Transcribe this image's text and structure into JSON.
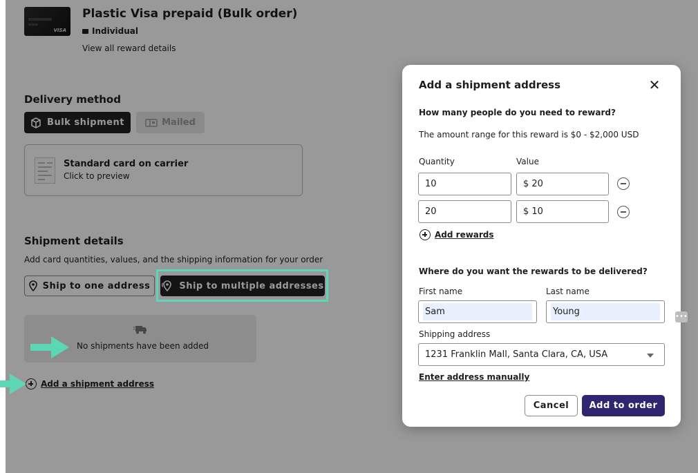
{
  "reward": {
    "title": "Plastic Visa prepaid (Bulk order)",
    "type": "Individual",
    "details_link": "View all reward details",
    "card_brand": "VISA"
  },
  "delivery": {
    "title": "Delivery method",
    "bulk_label": "Bulk shipment",
    "mailed_label": "Mailed",
    "carrier_title": "Standard card on carrier",
    "carrier_sub": "Click to preview"
  },
  "shipment": {
    "title": "Shipment details",
    "description": "Add card quantities, values, and the shipping information for your order",
    "one_address_label": "Ship to one address",
    "multi_address_label": "Ship to multiple addresses",
    "empty_text": "No shipments have been added",
    "add_address_link": "Add a shipment address"
  },
  "modal": {
    "title": "Add a shipment address",
    "question_people": "How many people do you need to reward?",
    "range_text": "The amount range for this reward is $0 - $2,000 USD",
    "quantity_label": "Quantity",
    "value_label": "Value",
    "rows": [
      {
        "quantity": "10",
        "value": "$ 20"
      },
      {
        "quantity": "20",
        "value": "$ 10"
      }
    ],
    "add_rewards_label": "Add rewards",
    "question_delivery": "Where do you want the rewards to be delivered?",
    "first_name_label": "First name",
    "last_name_label": "Last name",
    "first_name_value": "Sam",
    "last_name_value": "Young",
    "shipping_label": "Shipping address",
    "shipping_value": "1231 Franklin Mall, Santa Clara, CA, USA",
    "manual_link": "Enter address manually",
    "cancel_label": "Cancel",
    "add_label": "Add to order",
    "close_glyph": "✕",
    "dots_glyph": "•••"
  },
  "colors": {
    "accent": "#5dd6b5",
    "primary": "#2e2770",
    "dark_button": "#222222",
    "overlay": "rgba(0,0,0,0.40)"
  }
}
